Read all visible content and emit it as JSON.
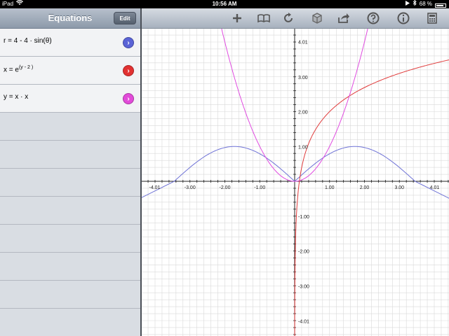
{
  "status": {
    "device": "iPad",
    "time": "10:56 AM",
    "battery": "68 %"
  },
  "sidebar": {
    "title": "Equations",
    "edit_label": "Edit",
    "equations": [
      {
        "lhs": "r",
        "rhs": "4 - 4 · sin(θ)",
        "color": "#5a63d6"
      },
      {
        "lhs": "x",
        "base": "e",
        "exp": "(y - 2 )",
        "color": "#e23131"
      },
      {
        "lhs": "y",
        "rhs": "x · x",
        "color": "#e24bd9"
      }
    ]
  },
  "toolbar": {
    "icons": [
      "plus-icon",
      "book-icon",
      "refresh-icon",
      "cube-icon",
      "share-icon",
      "help-icon",
      "info-icon",
      "calculator-icon"
    ]
  },
  "graph": {
    "x_ticks": [
      "-4.01",
      "-3.00",
      "-2.00",
      "-1.00",
      "1.00",
      "2.00",
      "3.00",
      "4.01"
    ],
    "y_ticks": [
      "4.01",
      "3.00",
      "2.00",
      "1.00",
      "-1.00",
      "-2.00",
      "-3.00",
      "-4.01"
    ],
    "colors": {
      "blue": "#6f73d6",
      "red": "#e03c3c",
      "magenta": "#e04be0",
      "grid": "#d9d9d9"
    }
  }
}
